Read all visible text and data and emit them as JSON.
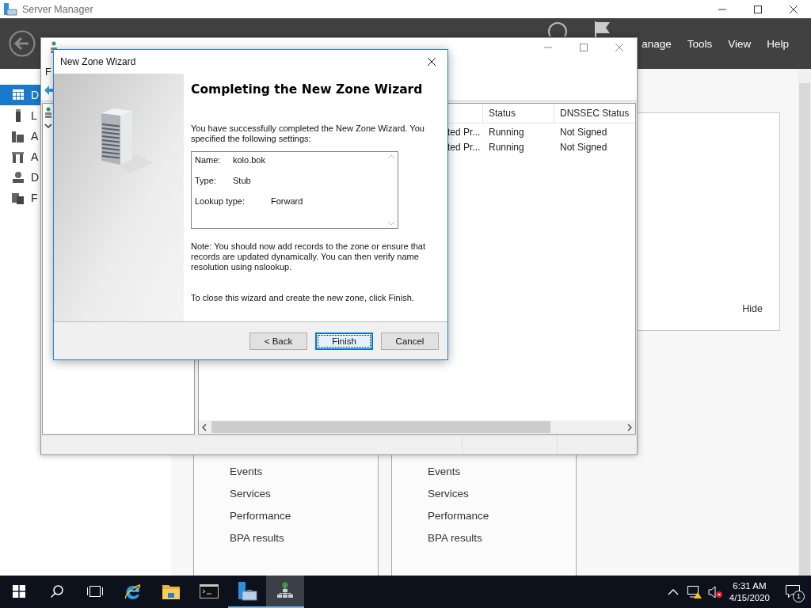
{
  "server_manager": {
    "title": "Server Manager",
    "menu": [
      "anage",
      "Tools",
      "View",
      "Help"
    ],
    "sidebar": [
      {
        "label": "D",
        "selected": true
      },
      {
        "label": "L",
        "selected": false
      },
      {
        "label": "A",
        "selected": false
      },
      {
        "label": "A",
        "selected": false
      },
      {
        "label": "D",
        "selected": false
      },
      {
        "label": "F",
        "selected": false
      }
    ],
    "welcome_panel": {
      "hide_link": "Hide"
    },
    "tiles": [
      {
        "links": [
          "Events",
          "Services",
          "Performance",
          "BPA results"
        ]
      },
      {
        "links": [
          "Events",
          "Services",
          "Performance",
          "BPA results"
        ]
      }
    ]
  },
  "dns_manager": {
    "menu": [
      "F"
    ],
    "columns": [
      "Status",
      "DNSSEC Status"
    ],
    "rows": [
      {
        "column_2": "ted Pr...",
        "status": "Running",
        "dnssec_status": "Not Signed"
      },
      {
        "column_2": "ted Pr...",
        "status": "Running",
        "dnssec_status": "Not Signed"
      }
    ]
  },
  "wizard": {
    "title": "New Zone Wizard",
    "heading": "Completing the New Zone Wizard",
    "intro": "You have successfully completed the New Zone Wizard. You specified the following settings:",
    "settings": [
      {
        "label": "Name:",
        "value": "kolo.bok"
      },
      {
        "label": "Type:",
        "value": "Stub"
      },
      {
        "label": "Lookup type:",
        "value": "Forward"
      }
    ],
    "note": "Note: You should now add records to the zone or ensure that records are updated dynamically. You can then verify name resolution using nslookup.",
    "finish_text": "To close this wizard and create the new zone, click Finish.",
    "buttons": [
      {
        "label": "< Back",
        "focused": false
      },
      {
        "label": "Finish",
        "focused": true
      },
      {
        "label": "Cancel",
        "focused": false
      }
    ]
  },
  "taskbar": {
    "apps": [
      {
        "kind": "browser",
        "running": false,
        "selected": false
      },
      {
        "kind": "folder",
        "running": false,
        "selected": false
      },
      {
        "kind": "console",
        "running": false,
        "selected": false
      },
      {
        "kind": "server",
        "running": true,
        "selected": false
      },
      {
        "kind": "network",
        "running": true,
        "selected": true
      }
    ],
    "time": "6:31 AM",
    "date": "4/15/2020",
    "notification_count": "1"
  }
}
